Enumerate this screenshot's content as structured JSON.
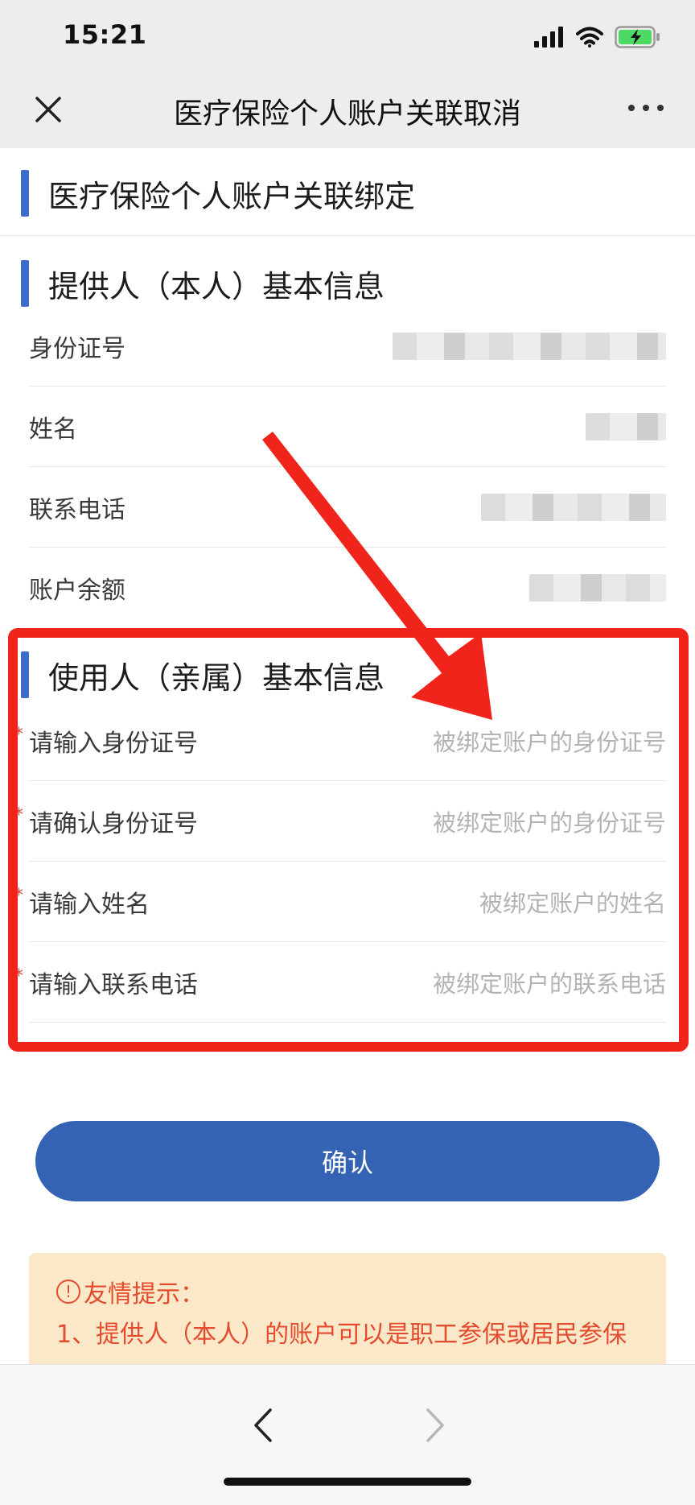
{
  "status_bar": {
    "time": "15:21"
  },
  "nav": {
    "title": "医疗保险个人账户关联取消"
  },
  "page": {
    "section_title": "医疗保险个人账户关联绑定"
  },
  "provider": {
    "title": "提供人（本人）基本信息",
    "rows": [
      {
        "label": "身份证号"
      },
      {
        "label": "姓名"
      },
      {
        "label": "联系电话"
      },
      {
        "label": "账户余额"
      }
    ]
  },
  "user": {
    "title": "使用人（亲属）基本信息",
    "fields": [
      {
        "label": "请输入身份证号",
        "placeholder": "被绑定账户的身份证号"
      },
      {
        "label": "请确认身份证号",
        "placeholder": "被绑定账户的身份证号"
      },
      {
        "label": "请输入姓名",
        "placeholder": "被绑定账户的姓名"
      },
      {
        "label": "请输入联系电话",
        "placeholder": "被绑定账户的联系电话"
      }
    ],
    "required_mark": "*"
  },
  "confirm_label": "确认",
  "tips": {
    "title": "友情提示：",
    "warn_icon_glyph": "!",
    "line1": "1、提供人（本人）的账户可以是职工参保或居民参保"
  },
  "colors": {
    "accent_bar": "#3e6cc9",
    "button": "#3563b3",
    "highlight": "#f0241b",
    "tips_bg": "#fbe8c8",
    "tips_text": "#e44b2e"
  }
}
